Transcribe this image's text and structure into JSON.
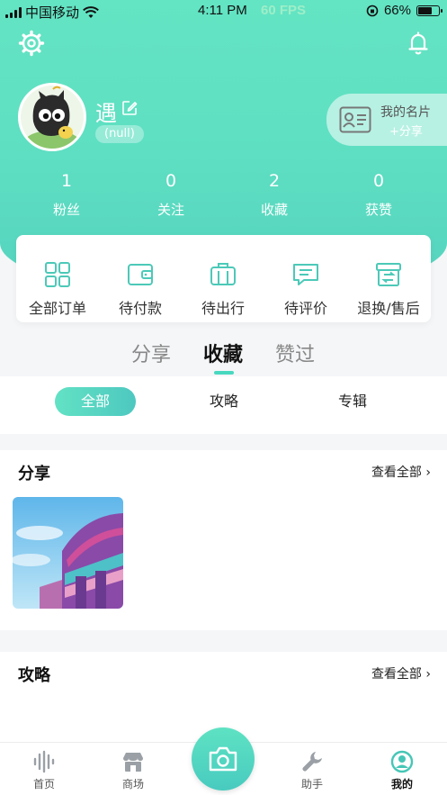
{
  "status_bar": {
    "carrier": "中国移动",
    "time": "4:11 PM",
    "fps": "60 FPS",
    "battery": "66%",
    "battery_level": 0.66
  },
  "profile": {
    "name": "遇",
    "badge": "(null)",
    "card_title": "我的名片",
    "card_action": "+分享"
  },
  "stats": [
    {
      "value": "1",
      "label": "粉丝"
    },
    {
      "value": "0",
      "label": "关注"
    },
    {
      "value": "2",
      "label": "收藏"
    },
    {
      "value": "0",
      "label": "获赞"
    }
  ],
  "orders": [
    {
      "label": "全部订单",
      "icon": "grid-icon"
    },
    {
      "label": "待付款",
      "icon": "wallet-icon"
    },
    {
      "label": "待出行",
      "icon": "suitcase-icon"
    },
    {
      "label": "待评价",
      "icon": "comment-icon"
    },
    {
      "label": "退换/售后",
      "icon": "return-box-icon"
    }
  ],
  "content_tabs": [
    {
      "label": "分享",
      "active": false
    },
    {
      "label": "收藏",
      "active": true
    },
    {
      "label": "赞过",
      "active": false
    }
  ],
  "filters": [
    {
      "label": "全部",
      "active": true
    },
    {
      "label": "攻略",
      "active": false
    },
    {
      "label": "专辑",
      "active": false
    }
  ],
  "sections": [
    {
      "title": "分享",
      "more": "查看全部 ›"
    },
    {
      "title": "攻略",
      "more": "查看全部 ›"
    }
  ],
  "tabbar": [
    {
      "label": "首页",
      "icon": "sound-wave-icon"
    },
    {
      "label": "商场",
      "icon": "store-icon"
    },
    {
      "label": "助手",
      "icon": "wrench-icon"
    },
    {
      "label": "我的",
      "icon": "user-circle-icon",
      "active": true
    }
  ],
  "colors": {
    "accent": "#5ee0c3",
    "accent_dark": "#48cbbf"
  }
}
